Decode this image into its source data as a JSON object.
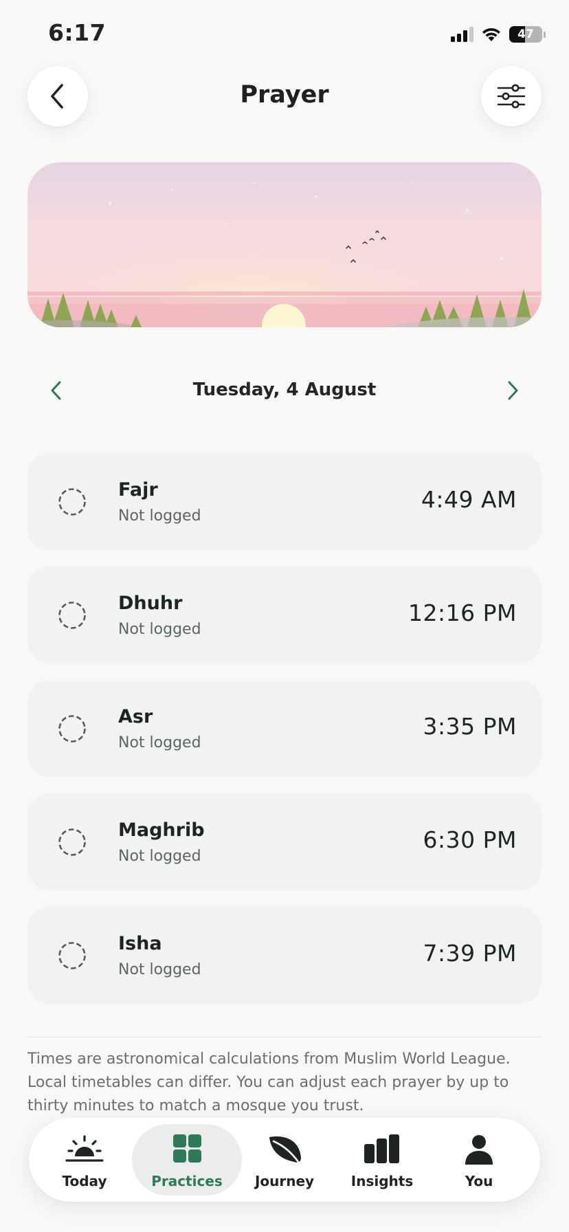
{
  "status_bar": {
    "time": "6:17",
    "battery_percent": "47",
    "battery_level": 0.47
  },
  "header": {
    "title": "Prayer",
    "back_icon": "chevron-left-icon",
    "filter_icon": "sliders-icon"
  },
  "date_nav": {
    "label": "Tuesday, 4 August",
    "prev_icon": "chevron-left-icon",
    "next_icon": "chevron-right-icon"
  },
  "prayers": [
    {
      "name": "Fajr",
      "status": "Not logged",
      "time": "4:49 AM"
    },
    {
      "name": "Dhuhr",
      "status": "Not logged",
      "time": "12:16 PM"
    },
    {
      "name": "Asr",
      "status": "Not logged",
      "time": "3:35 PM"
    },
    {
      "name": "Maghrib",
      "status": "Not logged",
      "time": "6:30 PM"
    },
    {
      "name": "Isha",
      "status": "Not logged",
      "time": "7:39 PM"
    }
  ],
  "note": "Times are astronomical calculations from Muslim World League. Local timetables can differ. You can adjust each prayer by up to thirty minutes to match a mosque you trust.",
  "tab_bar": {
    "active": "Practices",
    "tabs": [
      {
        "label": "Today",
        "icon": "sunrise-icon"
      },
      {
        "label": "Practices",
        "icon": "grid-icon"
      },
      {
        "label": "Journey",
        "icon": "leaf-icon"
      },
      {
        "label": "Insights",
        "icon": "bar-chart-icon"
      },
      {
        "label": "You",
        "icon": "person-icon"
      }
    ]
  },
  "colors": {
    "accent": "#2e7a57",
    "card_background": "#f1f3f2",
    "page_background": "#f8f8f7",
    "text_primary": "#1f2322",
    "text_secondary": "#5f6463"
  }
}
